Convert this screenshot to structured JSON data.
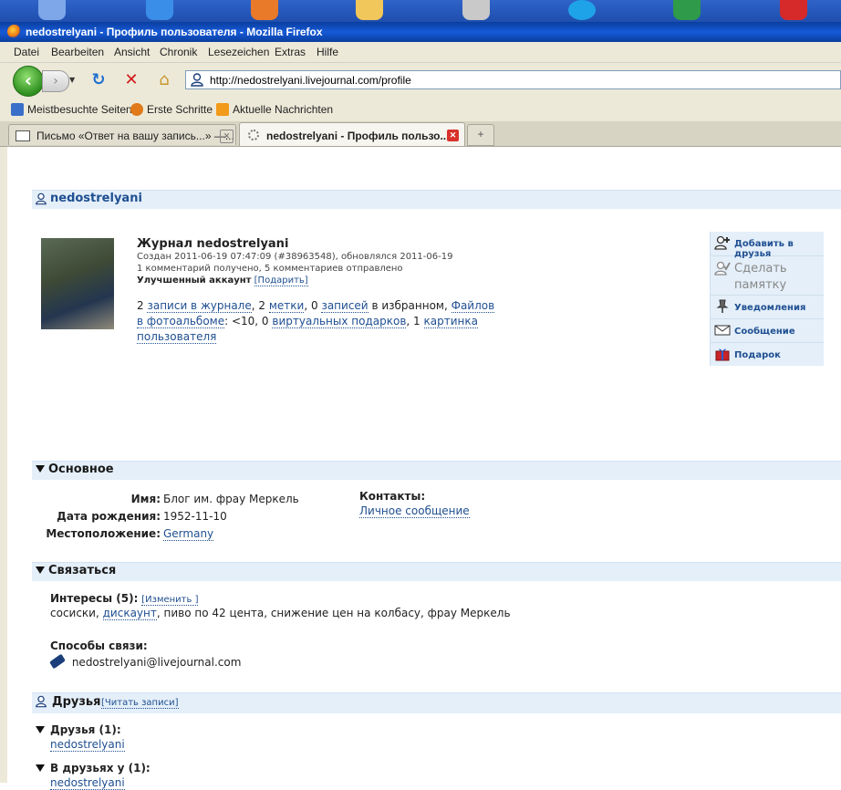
{
  "browser": {
    "title": "nedostrelyani - Профиль пользователя - Mozilla Firefox",
    "menu": [
      "Datei",
      "Bearbeiten",
      "Ansicht",
      "Chronik",
      "Lesezeichen",
      "Extras",
      "Hilfe"
    ],
    "url": "http://nedostrelyani.livejournal.com/profile",
    "bookmarks": [
      "Meistbesuchte Seiten",
      "Erste Schritte",
      "Aktuelle Nachrichten"
    ],
    "tabs": [
      {
        "label": "Письмо «Ответ на вашу запись...» —...",
        "active": false
      },
      {
        "label": "nedostrelyani - Профиль пользо...",
        "active": true
      }
    ],
    "new_tab": "+"
  },
  "profile": {
    "username": "nedostrelyani",
    "journal_title": "Журнал nedostrelyani",
    "created": "Создан 2011-06-19 07:47:09 (#38963548), обновлялся 2011-06-19",
    "comments": "1 комментарий получено, 5 комментариев отправлено",
    "account": "Улучшенный аккаунт",
    "gift_link": "[Подарить]",
    "stats": {
      "entries_count": "2",
      "entries_link": "записи в журнале",
      "tags_count": "2",
      "tags_link": "метки",
      "fav_count": "0",
      "fav_link": "записей",
      "fav_tail": "в избранном,",
      "photos_link": "Файлов в фотоальбоме",
      "photos_tail": ": <10, 0",
      "gifts_link": "виртуальных подарков",
      "pics_prefix": ", 1",
      "pics_link": "картинка пользователя"
    },
    "actions": {
      "add_friend": "Добавить в друзья",
      "memory": "Сделать памятку",
      "notify": "Уведомления",
      "message": "Сообщение",
      "gift": "Подарок"
    }
  },
  "basic": {
    "heading": "Основное",
    "name_label": "Имя:",
    "name_value": "Блог им. фрау Меркель",
    "birth_label": "Дата рождения:",
    "birth_value": "1952-11-10",
    "loc_label": "Местоположение:",
    "loc_value": "Germany",
    "contacts_label": "Контакты:",
    "contacts_value": "Личное сообщение"
  },
  "connect": {
    "heading": "Связаться",
    "interests_label": "Интересы (5):",
    "interests_edit": "[Изменить ]",
    "interests_a": "сосиски,",
    "interests_link": "дискаунт",
    "interests_b": ", пиво по 42 цента, снижение цен на колбасу, фрау Меркель",
    "ways_label": "Способы связи:",
    "email": "nedostrelyani@livejournal.com"
  },
  "friends": {
    "heading": "Друзья",
    "read_link": "[Читать записи]",
    "friends_label": "Друзья (1):",
    "friends_value": "nedostrelyani",
    "friendof_label": "В друзьях у (1):",
    "friendof_value": "nedostrelyani"
  }
}
